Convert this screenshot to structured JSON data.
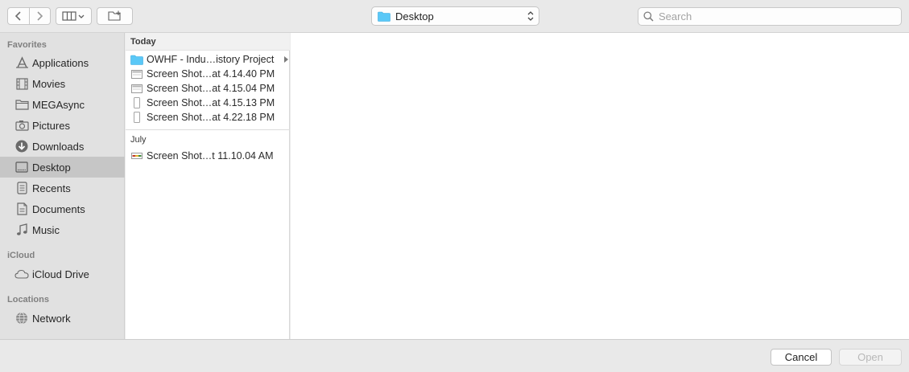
{
  "toolbar": {
    "location_label": "Desktop",
    "search_placeholder": "Search"
  },
  "sidebar": {
    "sections": [
      {
        "title": "Favorites",
        "items": [
          {
            "label": "Applications",
            "icon": "applications-icon"
          },
          {
            "label": "Movies",
            "icon": "film-icon"
          },
          {
            "label": "MEGAsync",
            "icon": "folder-icon"
          },
          {
            "label": "Pictures",
            "icon": "camera-icon"
          },
          {
            "label": "Downloads",
            "icon": "download-icon"
          },
          {
            "label": "Desktop",
            "icon": "desktop-icon",
            "selected": true
          },
          {
            "label": "Recents",
            "icon": "recents-icon"
          },
          {
            "label": "Documents",
            "icon": "document-icon"
          },
          {
            "label": "Music",
            "icon": "music-icon"
          }
        ]
      },
      {
        "title": "iCloud",
        "items": [
          {
            "label": "iCloud Drive",
            "icon": "cloud-icon"
          }
        ]
      },
      {
        "title": "Locations",
        "items": [
          {
            "label": "Network",
            "icon": "globe-icon"
          }
        ]
      }
    ]
  },
  "files": {
    "groups": [
      {
        "title": "Today",
        "items": [
          {
            "name": "OWHF - Indu…istory Project",
            "kind": "folder",
            "has_children": true
          },
          {
            "name": "Screen Shot…at 4.14.40 PM",
            "kind": "screenshot-wide"
          },
          {
            "name": "Screen Shot…at 4.15.04 PM",
            "kind": "screenshot-wide"
          },
          {
            "name": "Screen Shot…at 4.15.13 PM",
            "kind": "screenshot-tall"
          },
          {
            "name": "Screen Shot…at 4.22.18 PM",
            "kind": "screenshot-tall"
          }
        ]
      },
      {
        "title": "July",
        "items": [
          {
            "name": "Screen Shot…t 11.10.04 AM",
            "kind": "screenshot-color"
          }
        ]
      }
    ]
  },
  "buttons": {
    "cancel": "Cancel",
    "open": "Open"
  },
  "colors": {
    "folder_blue": "#5ac8f7",
    "selected_bg": "#c6c6c6",
    "sidebar_bg": "#e1e1e1"
  }
}
